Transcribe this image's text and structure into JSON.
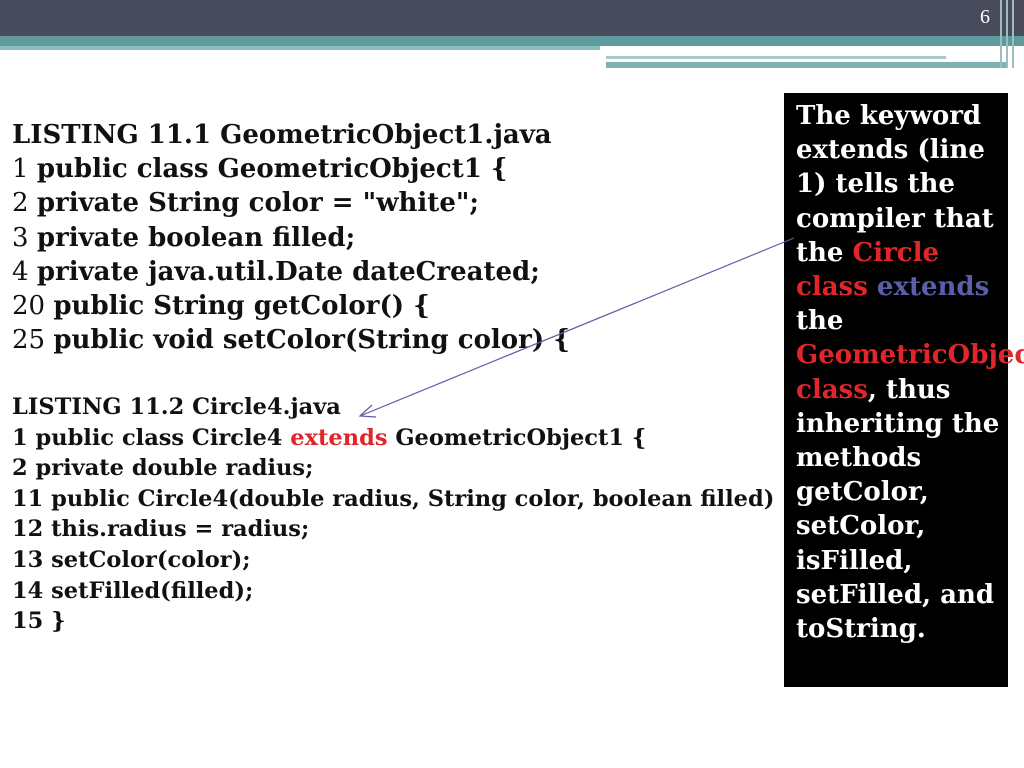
{
  "header": {
    "slide_number": "6"
  },
  "listing1": {
    "title": "LISTING 11.1 GeometricObject1.java",
    "lines": [
      {
        "num": "1",
        "code": "public class GeometricObject1 {"
      },
      {
        "num": "2",
        "code": "private String color = \"white\";"
      },
      {
        "num": "3",
        "code": "private boolean filled;"
      },
      {
        "num": "4",
        "code": "private java.util.Date dateCreated;"
      },
      {
        "num": "20",
        "code": "public String getColor() {"
      },
      {
        "num": "25",
        "code": "public void setColor(String color) {"
      }
    ]
  },
  "listing2": {
    "title": "LISTING 11.2 Circle4.java",
    "line1_pre": "1 public class Circle4 ",
    "line1_keyword": "extends",
    "line1_post": " GeometricObject1 {",
    "lines": [
      "2 private double radius;",
      "11 public Circle4(double radius, String color, boolean filled)",
      "12 this.radius = radius;",
      "13 setColor(color);",
      "14 setFilled(filled);",
      "15 }"
    ]
  },
  "callout": {
    "part1": "The keyword extends (line 1) tells the compiler that the ",
    "red1": "Circle class",
    "space1": " ",
    "blue1": "extends",
    "part2": " the ",
    "red2": "GeometricObject class",
    "part3": ", thus inheriting the methods getColor, setColor, isFilled, setFilled, and toString."
  },
  "colors": {
    "accent_red": "#e0262b",
    "accent_blue": "#5a5fa8",
    "header_dark": "#474b5c",
    "header_teal": "#5f9a9c"
  }
}
